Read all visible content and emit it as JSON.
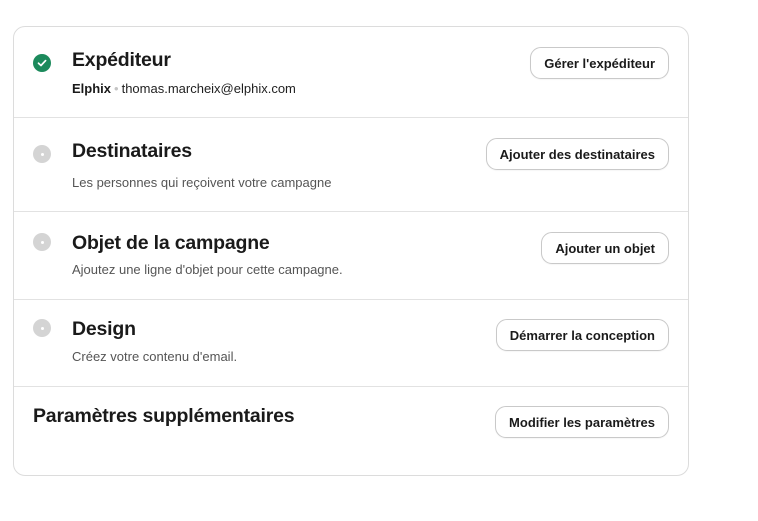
{
  "sections": {
    "sender": {
      "status": "done",
      "title": "Expéditeur",
      "sender_name": "Elphix",
      "separator": "•",
      "sender_email": "thomas.marcheix@elphix.com",
      "button": "Gérer l'expéditeur"
    },
    "recipients": {
      "status": "pending",
      "title": "Destinataires",
      "description": "Les personnes qui reçoivent votre campagne",
      "button": "Ajouter des destinataires"
    },
    "subject": {
      "status": "pending",
      "title": "Objet de la campagne",
      "description": "Ajoutez une ligne d'objet pour cette campagne.",
      "button": "Ajouter un objet"
    },
    "design": {
      "status": "pending",
      "title": "Design",
      "description": "Créez votre contenu d'email.",
      "button": "Démarrer la conception"
    },
    "settings": {
      "title": "Paramètres supplémentaires",
      "button": "Modifier les paramètres"
    }
  },
  "colors": {
    "done": "#1c8a5c",
    "pending": "#d4d4d4",
    "border": "#dcdcdc"
  },
  "icons": {
    "done": "check-circle-icon",
    "pending": "pending-circle-icon"
  }
}
